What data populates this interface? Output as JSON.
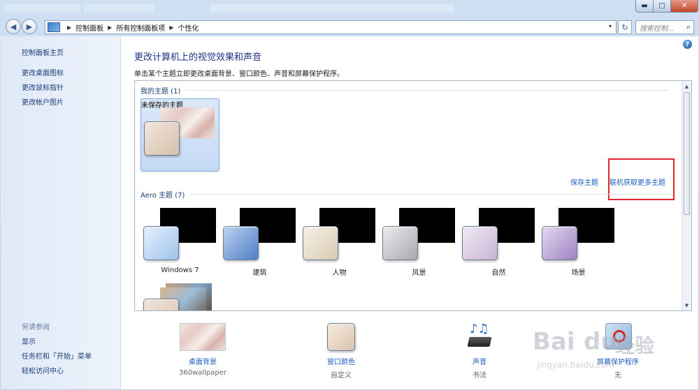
{
  "window": {
    "controls": {
      "minimize": "▬",
      "maximize": "□",
      "close": "✕"
    }
  },
  "address": {
    "crumbs": [
      "控制面板",
      "所有控制面板项",
      "个性化"
    ],
    "dropdown": "▾",
    "refresh": "↻",
    "search_placeholder": "搜索控制...",
    "search_icon": "⌕"
  },
  "nav": {
    "back": "◀",
    "forward": "▶"
  },
  "sidebar": {
    "home": "控制面板主页",
    "links": [
      "更改桌面图标",
      "更改鼠标指针",
      "更改帐户图片"
    ],
    "see_also_title": "另请参阅",
    "see_also": [
      "显示",
      "任务栏和「开始」菜单",
      "轻松访问中心"
    ]
  },
  "main": {
    "help": "?",
    "heading": "更改计算机上的视觉效果和声音",
    "description": "单击某个主题立即更改桌面背景、窗口颜色、声音和屏幕保护程序。",
    "my_themes": {
      "title": "我的主题 (1)",
      "items": [
        {
          "name": "未保存的主题"
        }
      ]
    },
    "save_theme": "保存主题",
    "get_more_online": "联机获取更多主题",
    "aero_themes": {
      "title": "Aero 主题 (7)",
      "items": [
        {
          "name": "Windows 7",
          "color": "#9cc3ec"
        },
        {
          "name": "建筑",
          "color": "#4d7ec7"
        },
        {
          "name": "人物",
          "color": "#d9cbb3"
        },
        {
          "name": "风景",
          "color": "#a8a8ad"
        },
        {
          "name": "自然",
          "color": "#c7b4d3"
        },
        {
          "name": "场景",
          "color": "#9d82c2"
        }
      ]
    },
    "scroll": {
      "up": "▲",
      "down": "▼"
    }
  },
  "bottom_bar": {
    "desktop_background": {
      "label": "桌面背景",
      "value": "360wallpaper"
    },
    "window_color": {
      "label": "窗口颜色",
      "value": "自定义"
    },
    "sounds": {
      "label": "声音",
      "value": "书法"
    },
    "screen_saver": {
      "label": "屏幕保护程序",
      "value": "无"
    }
  },
  "watermark": {
    "brand": "Bai",
    "brand2": "du",
    "cn": "经验",
    "url": "jingyan.baidu.com"
  }
}
